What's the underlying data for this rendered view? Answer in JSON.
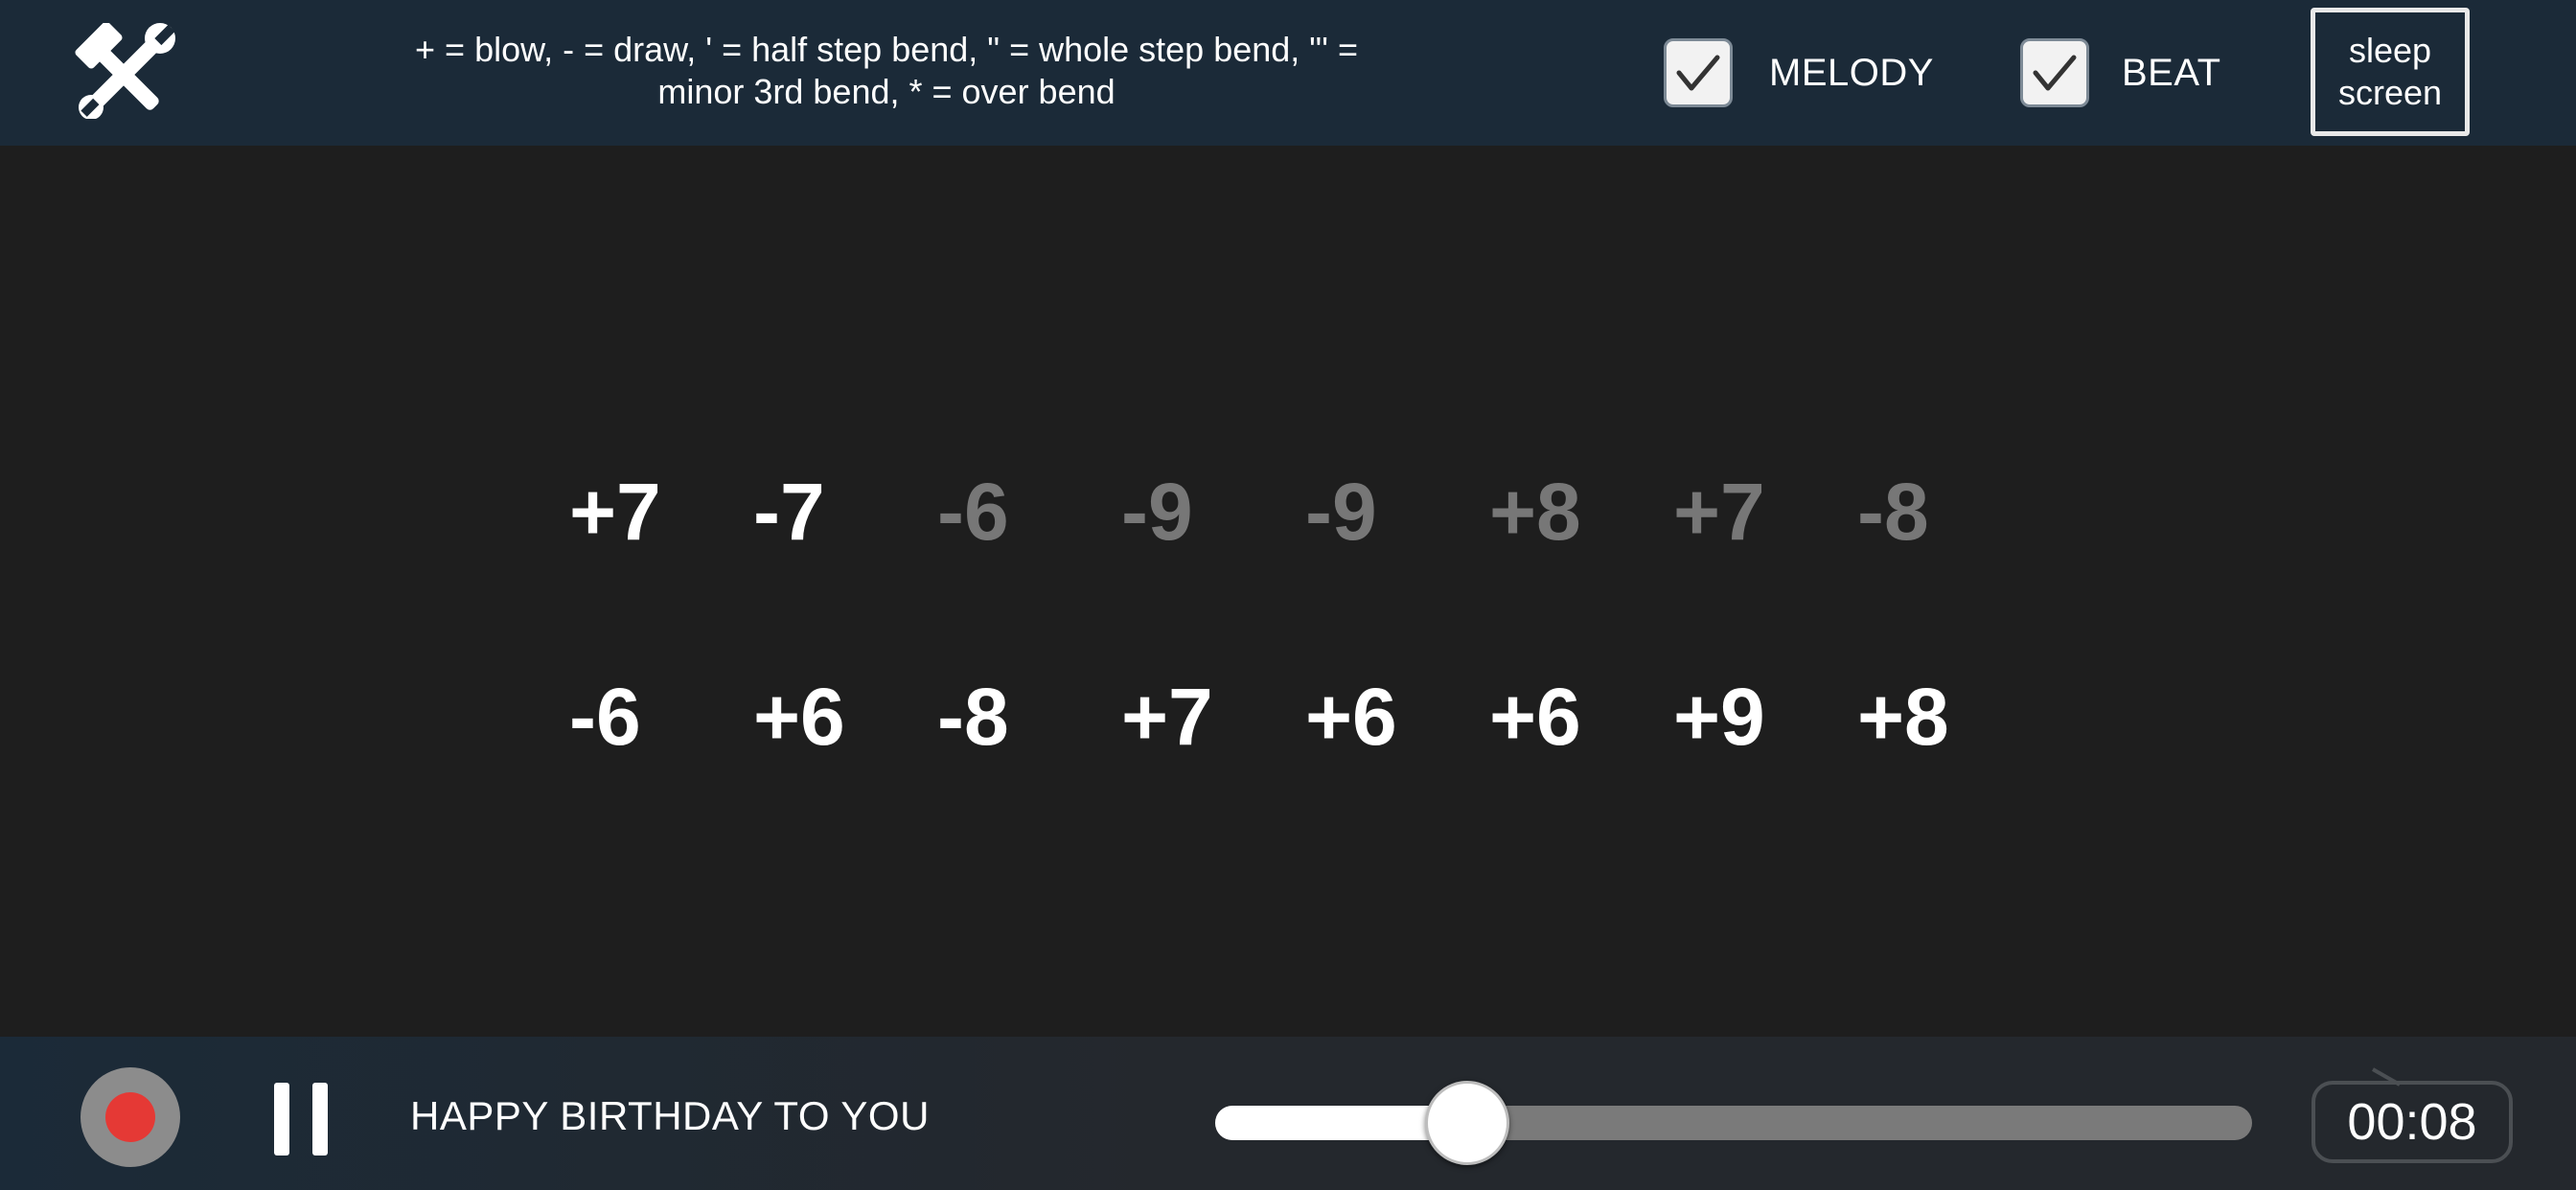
{
  "header": {
    "tools_icon": "hammer-wrench-icon",
    "legend_line1": "+ = blow, - = draw, ' = half step bend, \" = whole step bend, \"' =",
    "legend_line2": "minor 3rd bend, * = over bend",
    "melody_label": "MELODY",
    "melody_checked": true,
    "beat_label": "BEAT",
    "beat_checked": true,
    "sleep_line1": "sleep",
    "sleep_line2": "screen"
  },
  "tab": {
    "row1": [
      {
        "text": "+7",
        "state": "played"
      },
      {
        "text": "-7",
        "state": "played"
      },
      {
        "text": "-6",
        "state": "upcoming"
      },
      {
        "text": "-9",
        "state": "upcoming"
      },
      {
        "text": "-9",
        "state": "upcoming"
      },
      {
        "text": "+8",
        "state": "upcoming"
      },
      {
        "text": "+7",
        "state": "upcoming"
      },
      {
        "text": "-8",
        "state": "upcoming"
      }
    ],
    "row2": [
      {
        "text": "-6",
        "state": "played"
      },
      {
        "text": "+6",
        "state": "played"
      },
      {
        "text": "-8",
        "state": "played"
      },
      {
        "text": "+7",
        "state": "played"
      },
      {
        "text": "+6",
        "state": "played"
      },
      {
        "text": "+6",
        "state": "played"
      },
      {
        "text": "+9",
        "state": "played"
      },
      {
        "text": "+8",
        "state": "played"
      }
    ]
  },
  "player": {
    "record_icon": "record-icon",
    "pause_icon": "pause-icon",
    "song_title": "HAPPY BIRTHDAY TO YOU",
    "progress": 0.2,
    "time": "00:08"
  },
  "colors": {
    "played": "#ffffff",
    "upcoming": "#777777",
    "record": "#e53935"
  }
}
